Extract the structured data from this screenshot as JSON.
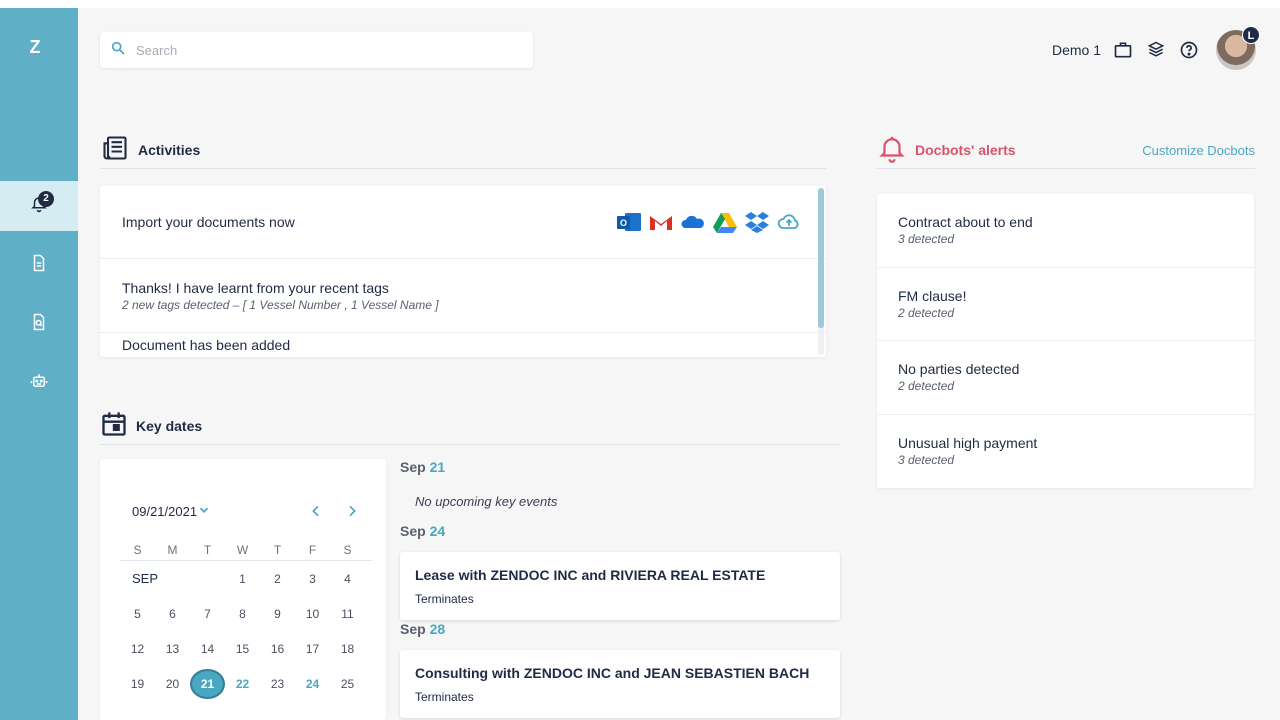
{
  "sidebar": {
    "logo": "Z",
    "notifications_badge": "2",
    "items": [
      "notifications",
      "documents",
      "search-documents",
      "docbots"
    ]
  },
  "search": {
    "placeholder": "Search"
  },
  "header": {
    "user_name": "Demo 1",
    "avatar_badge": "L"
  },
  "activities": {
    "title": "Activities",
    "rows": [
      {
        "main": "Import your documents now"
      },
      {
        "main": "Thanks! I have learnt from your recent tags",
        "sub": "2 new tags detected  –  [ 1 Vessel Number ,  1 Vessel Name ]"
      },
      {
        "main": "Document has been added"
      }
    ],
    "import_sources": [
      "outlook-icon",
      "gmail-icon",
      "onedrive-icon",
      "google-drive-icon",
      "dropbox-icon",
      "cloud-upload-icon"
    ]
  },
  "key_dates": {
    "title": "Key dates",
    "selected_date": "09/21/2021",
    "weekdays": [
      "S",
      "M",
      "T",
      "W",
      "T",
      "F",
      "S"
    ],
    "month_label": "SEP",
    "weeks": [
      [
        "",
        "",
        "",
        "1",
        "2",
        "3",
        "4"
      ],
      [
        "5",
        "6",
        "7",
        "8",
        "9",
        "10",
        "11"
      ],
      [
        "12",
        "13",
        "14",
        "15",
        "16",
        "17",
        "18"
      ],
      [
        "19",
        "20",
        "21",
        "22",
        "23",
        "24",
        "25"
      ]
    ],
    "today": "21",
    "event_days": [
      "22",
      "24"
    ],
    "events": [
      {
        "month": "Sep",
        "day": "21",
        "empty_text": "No upcoming key events"
      },
      {
        "month": "Sep",
        "day": "24",
        "title": "Lease with ZENDOC INC and RIVIERA REAL ESTATE",
        "sub": "Terminates"
      },
      {
        "month": "Sep",
        "day": "28",
        "title": "Consulting with ZENDOC INC and JEAN SEBASTIEN BACH",
        "sub": "Terminates"
      }
    ]
  },
  "alerts": {
    "title": "Docbots' alerts",
    "customize_label": "Customize Docbots",
    "items": [
      {
        "main": "Contract about to end",
        "sub": "3 detected"
      },
      {
        "main": "FM clause!",
        "sub": "2 detected"
      },
      {
        "main": "No parties detected",
        "sub": "2 detected"
      },
      {
        "main": "Unusual high payment",
        "sub": "3 detected"
      }
    ]
  },
  "colors": {
    "sidebar": "#5fafc7",
    "accent": "#4aa7c2",
    "alert": "#d9546b",
    "navy": "#1f2a44"
  }
}
